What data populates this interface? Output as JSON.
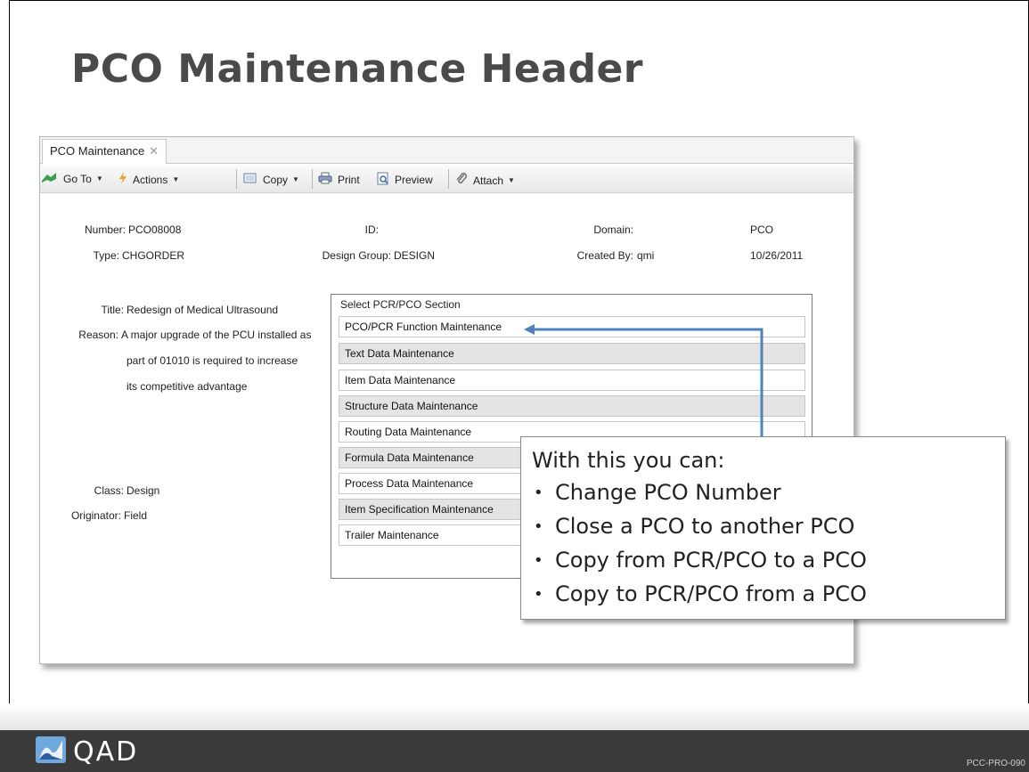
{
  "slide": {
    "title": "PCO Maintenance Header",
    "code": "PCC-PRO-090",
    "logo_text": "QAD"
  },
  "window": {
    "tab_label": "PCO Maintenance",
    "tab_close": "✕",
    "toolbar": {
      "goto": "Go To",
      "actions": "Actions",
      "copy": "Copy",
      "print": "Print",
      "preview": "Preview",
      "attach": "Attach"
    }
  },
  "form": {
    "number_label": "Number:",
    "number_value": "PCO08008",
    "type_label": "Type:",
    "type_value": "CHGORDER",
    "id_label": "ID:",
    "id_value": "",
    "design_group_label": "Design Group:",
    "design_group_value": "DESIGN",
    "domain_label": "Domain:",
    "domain_value": "PCO",
    "created_by_label": "Created By:",
    "created_by_value": "qmi",
    "created_date": "10/26/2011",
    "title_label": "Title:",
    "title_value": "Redesign of Medical Ultrasound",
    "reason_label": "Reason:",
    "reason_lines": [
      "A major upgrade of the PCU installed as",
      "part of 01010 is required to increase",
      "its competitive advantage"
    ],
    "class_label": "Class:",
    "class_value": "Design",
    "originator_label": "Originator:",
    "originator_value": "Field"
  },
  "section_select": {
    "title": "Select PCR/PCO Section",
    "items": [
      "PCO/PCR Function Maintenance",
      "Text Data Maintenance",
      "Item Data Maintenance",
      "Structure Data Maintenance",
      "Routing Data Maintenance",
      "Formula Data Maintenance",
      "Process Data Maintenance",
      "Item Specification Maintenance",
      "Trailer Maintenance"
    ]
  },
  "callout": {
    "heading": "With this you can:",
    "bullets": [
      "Change PCO Number",
      "Close a PCO to another PCO",
      "Copy from PCR/PCO to a PCO",
      "Copy to PCR/PCO from a PCO"
    ]
  },
  "colors": {
    "arrow": "#4f81bd",
    "title": "#4a4a4a",
    "footer": "#3a3a3a",
    "row_alt": "#e4e4e4"
  }
}
